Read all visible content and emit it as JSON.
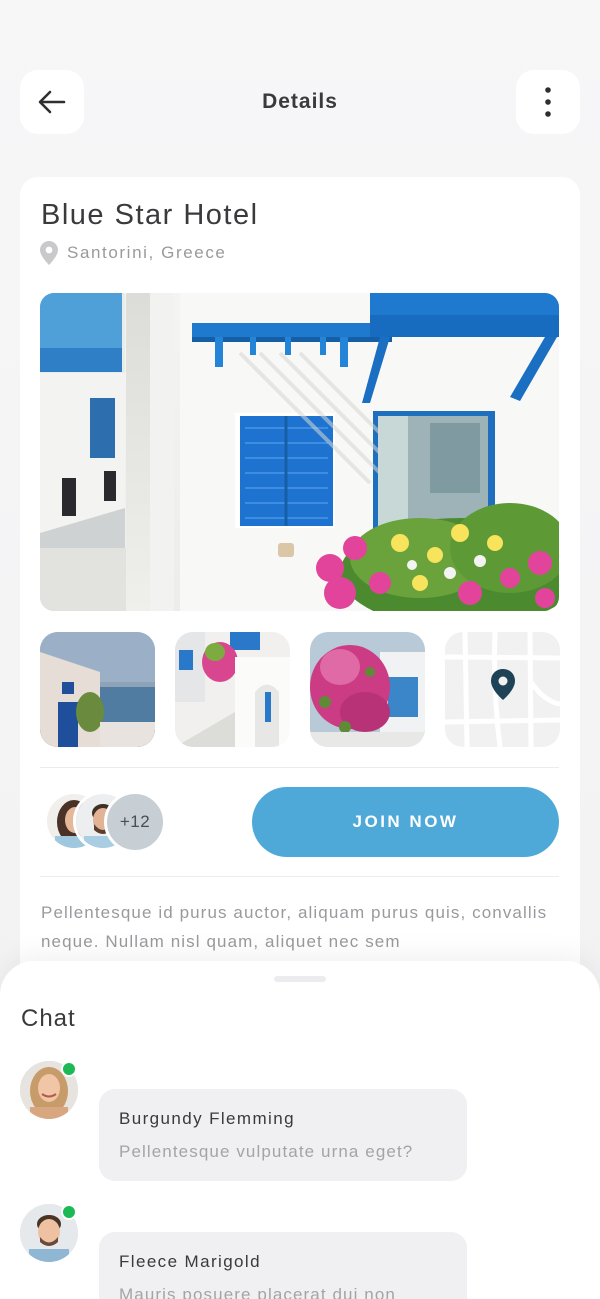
{
  "header": {
    "title": "Details",
    "back_icon": "arrow-left-icon",
    "more_icon": "vertical-ellipsis-icon"
  },
  "hotel": {
    "name": "Blue Star Hotel",
    "location": "Santorini, Greece",
    "location_icon": "map-pin-icon"
  },
  "gallery": {
    "thumbnails": [
      "santorini-cliff-photo",
      "blue-arch-alley-photo",
      "bougainvillea-balcony-photo",
      "map-thumbnail"
    ]
  },
  "members": {
    "extra_count": "+12"
  },
  "actions": {
    "join_label": "JOIN NOW"
  },
  "description": "Pellentesque id purus auctor, aliquam purus quis, convallis neque. Nullam nisl quam, aliquet nec sem",
  "chat": {
    "title": "Chat",
    "messages": [
      {
        "name": "Burgundy Flemming",
        "text": "Pellentesque vulputate urna eget?",
        "online": true
      },
      {
        "name": "Fleece Marigold",
        "text": "Mauris posuere placerat dui non",
        "online": true
      }
    ]
  },
  "colors": {
    "accent": "#4fa9d8",
    "online": "#1db954",
    "map_pin": "#1f4356"
  }
}
